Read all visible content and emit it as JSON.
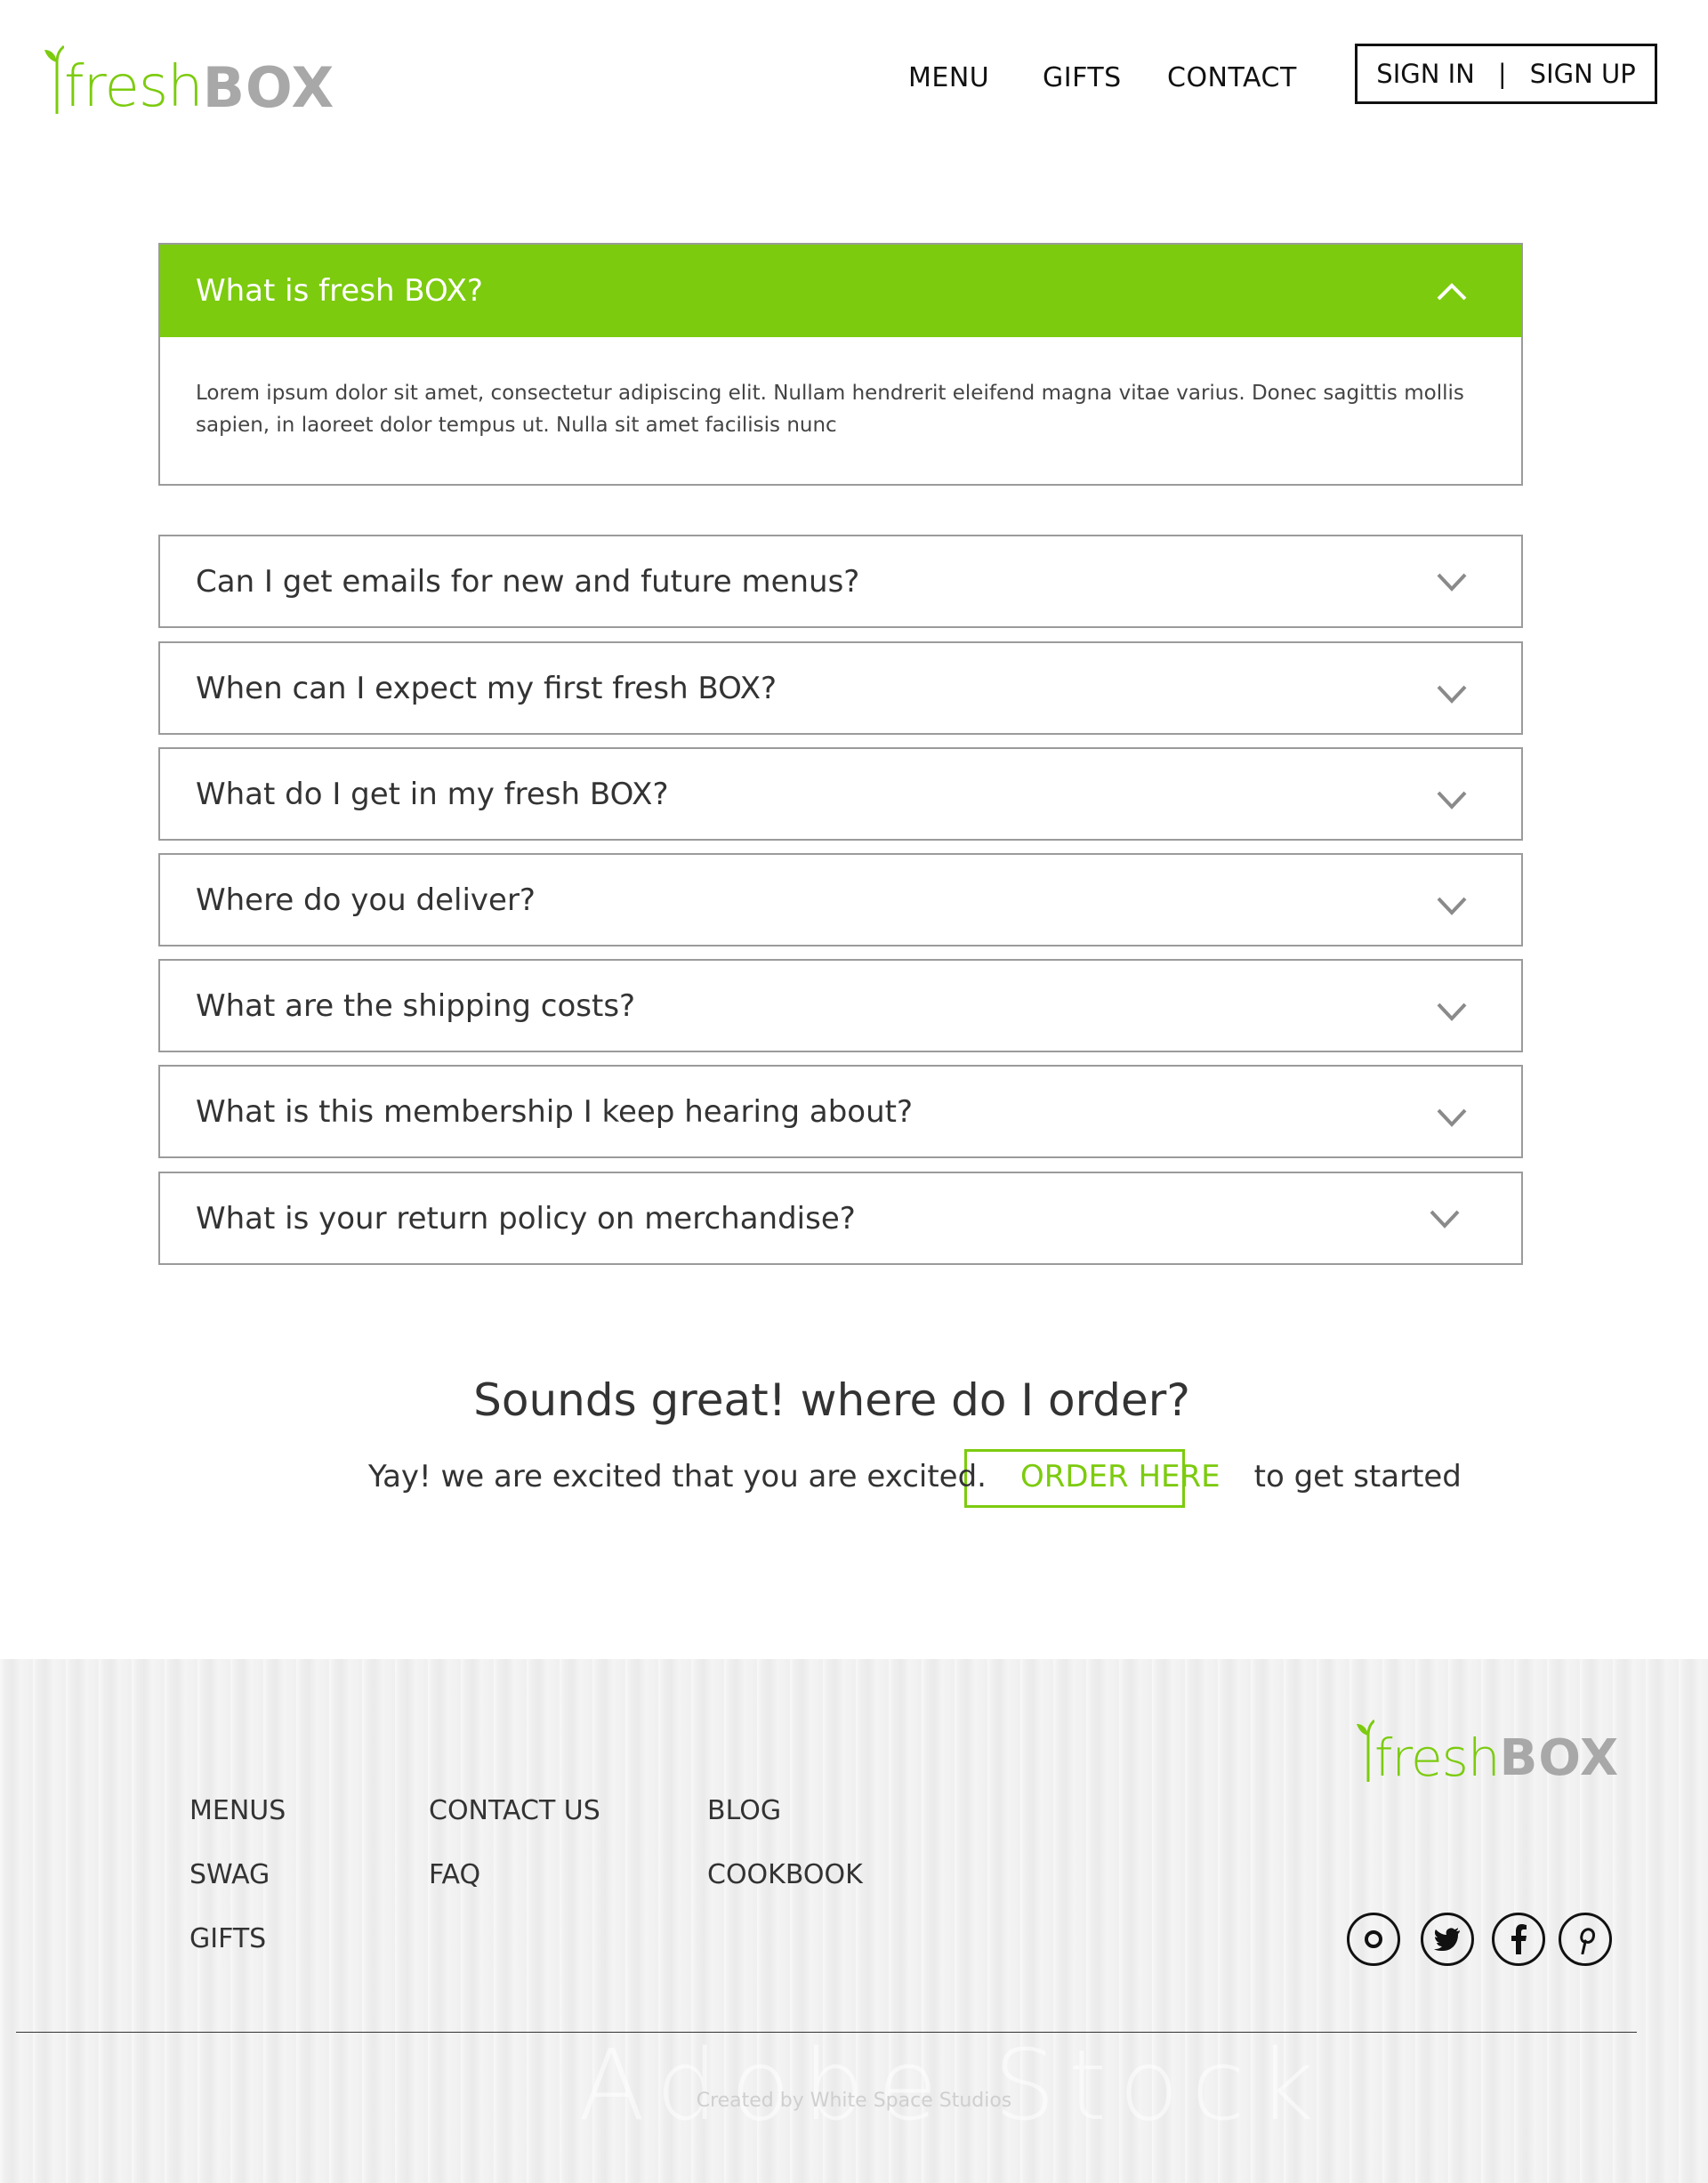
{
  "brand": {
    "logo_fresh": "fresh",
    "logo_box": "BOX",
    "accent_color": "#7ccb0e",
    "logo_gray": "#a8a8a8"
  },
  "header": {
    "nav": [
      "MENU",
      "GIFTS",
      "CONTACT"
    ],
    "sign_in": "SIGN IN",
    "separator": "|",
    "sign_up": "SIGN UP"
  },
  "faq": {
    "open_item": {
      "question": "What is fresh BOX?",
      "answer": "Lorem ipsum dolor sit amet, consectetur adipiscing elit. Nullam hendrerit eleifend magna vitae varius. Donec sagittis mollis sapien, in laoreet dolor tempus ut. Nulla sit amet facilisis nunc",
      "icon": "chevron-up-icon"
    },
    "items": [
      "Can I get emails for new and future menus?",
      "When can I expect my first fresh BOX?",
      "What do I get in my fresh BOX?",
      "Where do you deliver?",
      "What are the shipping costs?",
      "What is this membership I keep hearing about?",
      "What is your return policy on merchandise?"
    ]
  },
  "cta": {
    "title": "Sounds great! where do I order?",
    "lead": "Yay! we are excited that you are excited.",
    "button": "ORDER HERE",
    "trail": "to get started"
  },
  "footer": {
    "col1": [
      "MENUS",
      "SWAG",
      "GIFTS"
    ],
    "col2": [
      "CONTACT US",
      "FAQ"
    ],
    "col3": [
      "BLOG",
      "COOKBOOK"
    ],
    "social": [
      "instagram-icon",
      "twitter-icon",
      "facebook-icon",
      "pinterest-icon"
    ],
    "watermark": "Adobe Stock",
    "credit": "Created by White Space Studios"
  }
}
